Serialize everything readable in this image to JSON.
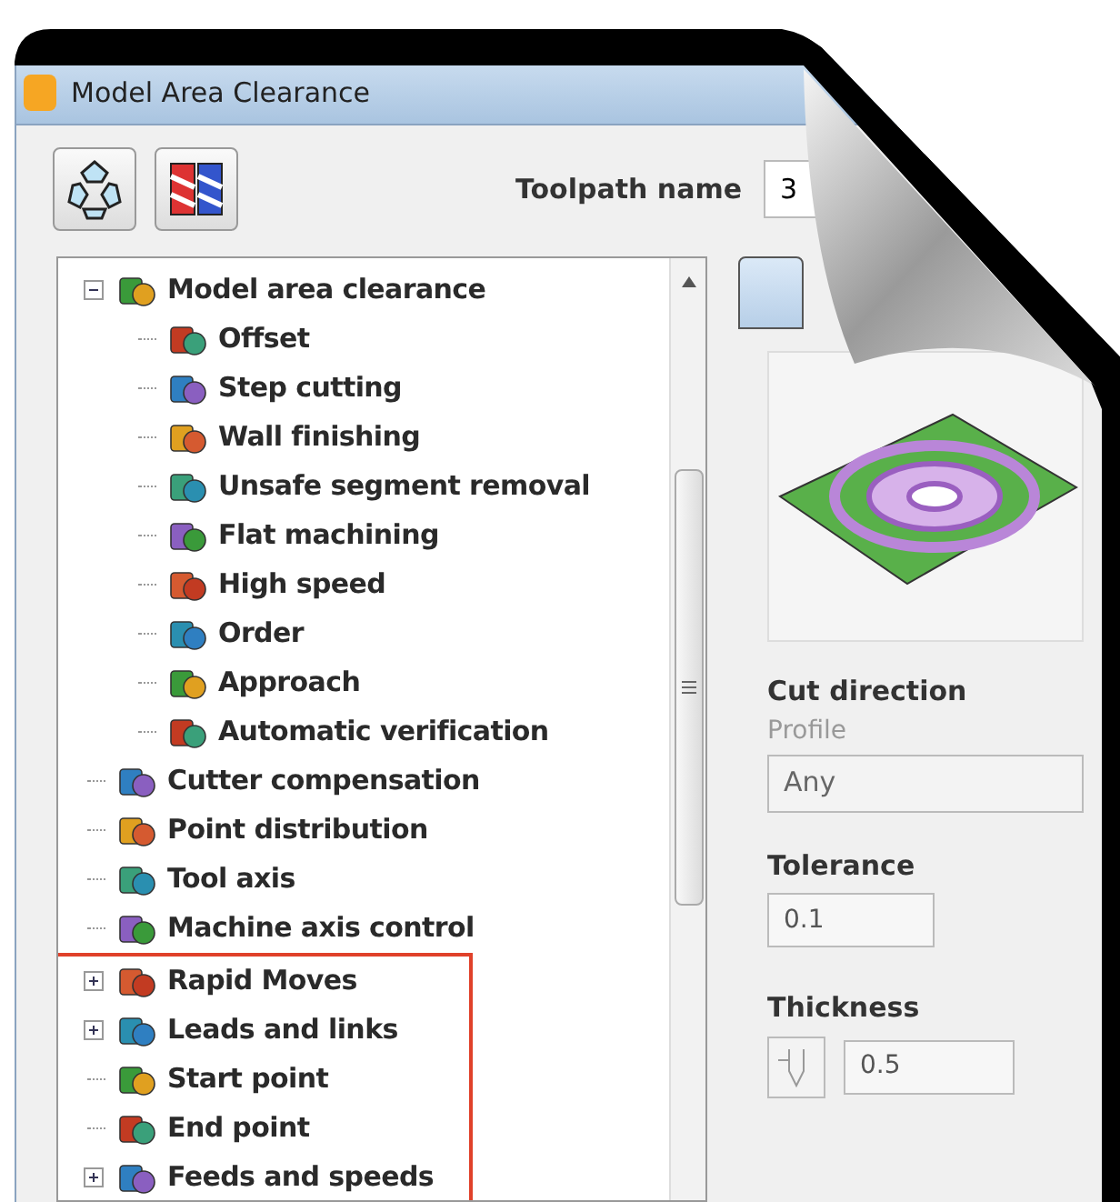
{
  "window": {
    "title": "Model Area Clearance"
  },
  "toolpath_name": {
    "label": "Toolpath name",
    "value": "3"
  },
  "tree": {
    "items": [
      {
        "label": "Model area clearance",
        "expanded": true,
        "highlighted": false,
        "children": [
          {
            "label": "Offset"
          },
          {
            "label": "Step cutting"
          },
          {
            "label": "Wall finishing"
          },
          {
            "label": "Unsafe segment removal"
          },
          {
            "label": "Flat machining"
          },
          {
            "label": "High speed"
          },
          {
            "label": "Order"
          },
          {
            "label": "Approach"
          },
          {
            "label": "Automatic verification"
          }
        ]
      },
      {
        "label": "Cutter compensation",
        "highlighted": false
      },
      {
        "label": "Point distribution",
        "highlighted": false
      },
      {
        "label": "Tool axis",
        "highlighted": false
      },
      {
        "label": "Machine axis control",
        "highlighted": false
      },
      {
        "label": "Rapid Moves",
        "expanded": false,
        "highlighted": true
      },
      {
        "label": "Leads and links",
        "expanded": false,
        "highlighted": true
      },
      {
        "label": "Start point",
        "highlighted": true
      },
      {
        "label": "End point",
        "highlighted": true
      },
      {
        "label": "Feeds and speeds",
        "expanded": false,
        "highlighted": true
      }
    ]
  },
  "panel": {
    "cut_direction": {
      "heading": "Cut direction",
      "sublabel": "Profile",
      "value": "Any"
    },
    "tolerance": {
      "heading": "Tolerance",
      "value": "0.1"
    },
    "thickness": {
      "heading": "Thickness",
      "value": "0.5"
    }
  }
}
